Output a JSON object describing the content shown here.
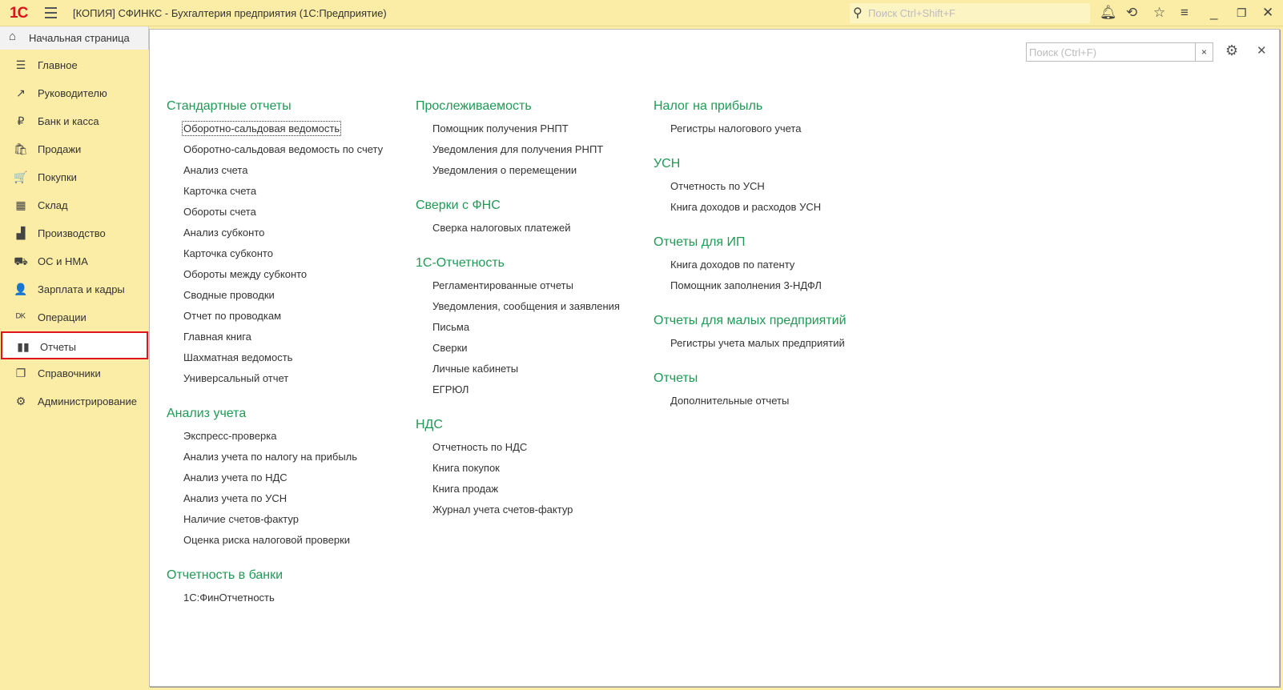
{
  "titlebar": {
    "logo": "1С",
    "title": "[КОПИЯ] СФИНКС - Бухгалтерия предприятия  (1С:Предприятие)",
    "search_placeholder": "Поиск Ctrl+Shift+F"
  },
  "home_tab": "Начальная страница",
  "sidebar": {
    "items": [
      {
        "label": "Главное",
        "icon": "☰"
      },
      {
        "label": "Руководителю",
        "icon": "↗"
      },
      {
        "label": "Банк и касса",
        "icon": "₽"
      },
      {
        "label": "Продажи",
        "icon": "🛍"
      },
      {
        "label": "Покупки",
        "icon": "🛒"
      },
      {
        "label": "Склад",
        "icon": "▦"
      },
      {
        "label": "Производство",
        "icon": "▟"
      },
      {
        "label": "ОС и НМА",
        "icon": "⛟"
      },
      {
        "label": "Зарплата и кадры",
        "icon": "👤"
      },
      {
        "label": "Операции",
        "icon": "ᴰᴷ"
      },
      {
        "label": "Отчеты",
        "icon": "▮▮"
      },
      {
        "label": "Справочники",
        "icon": "❐"
      },
      {
        "label": "Администрирование",
        "icon": "⚙"
      }
    ],
    "active": "Отчеты"
  },
  "main": {
    "search_placeholder": "Поиск (Ctrl+F)",
    "columns": [
      [
        {
          "title": "Стандартные отчеты",
          "items": [
            "Оборотно-сальдовая ведомость",
            "Оборотно-сальдовая ведомость по счету",
            "Анализ счета",
            "Карточка счета",
            "Обороты счета",
            "Анализ субконто",
            "Карточка субконто",
            "Обороты между субконто",
            "Сводные проводки",
            "Отчет по проводкам",
            "Главная книга",
            "Шахматная ведомость",
            "Универсальный отчет"
          ]
        },
        {
          "title": "Анализ учета",
          "items": [
            "Экспресс-проверка",
            "Анализ учета по налогу на прибыль",
            "Анализ учета по НДС",
            "Анализ учета по УСН",
            "Наличие счетов-фактур",
            "Оценка риска налоговой проверки"
          ]
        },
        {
          "title": "Отчетность в банки",
          "items": [
            "1С:ФинОтчетность"
          ]
        }
      ],
      [
        {
          "title": "Прослеживаемость",
          "items": [
            "Помощник получения РНПТ",
            "Уведомления для получения РНПТ",
            "Уведомления о перемещении"
          ]
        },
        {
          "title": "Сверки с ФНС",
          "items": [
            "Сверка налоговых платежей"
          ]
        },
        {
          "title": "1С-Отчетность",
          "items": [
            "Регламентированные отчеты",
            "Уведомления, сообщения и заявления",
            "Письма",
            "Сверки",
            "Личные кабинеты",
            "ЕГРЮЛ"
          ]
        },
        {
          "title": "НДС",
          "items": [
            "Отчетность по НДС",
            "Книга покупок",
            "Книга продаж",
            "Журнал учета счетов-фактур"
          ]
        }
      ],
      [
        {
          "title": "Налог на прибыль",
          "items": [
            "Регистры налогового учета"
          ]
        },
        {
          "title": "УСН",
          "items": [
            "Отчетность по УСН",
            "Книга доходов и расходов УСН"
          ]
        },
        {
          "title": "Отчеты для ИП",
          "items": [
            "Книга доходов по патенту",
            "Помощник заполнения 3-НДФЛ"
          ]
        },
        {
          "title": "Отчеты для малых предприятий",
          "items": [
            "Регистры учета малых предприятий"
          ]
        },
        {
          "title": "Отчеты",
          "items": [
            "Дополнительные отчеты"
          ]
        }
      ]
    ]
  }
}
